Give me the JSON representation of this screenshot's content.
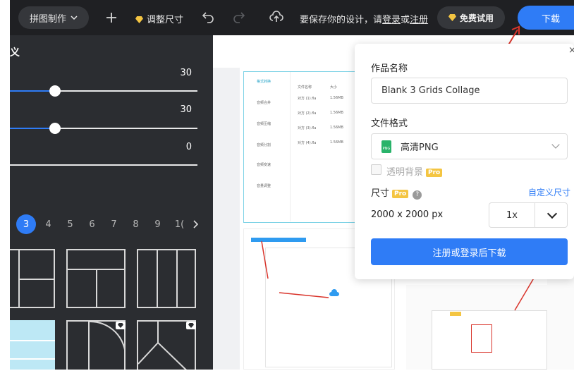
{
  "topbar": {
    "menu_label": "拼图制作",
    "add_icon": "plus-icon",
    "resize_label": "调整尺寸",
    "undo_icon": "undo-icon",
    "redo_icon": "redo-icon",
    "cloud_icon": "cloud-upload-icon",
    "save_prompt_prefix": "要保存你的设计，请",
    "login_link": "登录",
    "or_text": "或",
    "register_link": "注册",
    "trial_label": "免费试用",
    "download_label": "下载"
  },
  "left_panel": {
    "title_fragment": "义",
    "sliders": [
      {
        "value_text": "30",
        "level": 0.24
      },
      {
        "value_text": "30",
        "level": 0.24
      },
      {
        "value_text": "0",
        "level": 0
      }
    ],
    "pages": [
      "3",
      "4",
      "5",
      "6",
      "7",
      "8",
      "9",
      "1("
    ],
    "active_page": "3",
    "next_icon": "chevron-right-icon"
  },
  "canvas": {
    "mini_texts": [
      "格式转换",
      "文件名称",
      "大小",
      "音频合并",
      "音频压缩",
      "音频分割",
      "音频变速",
      "音量调整",
      "对方 (1).fla",
      "对方 (2).fla",
      "对方 (3).fla",
      "对方 (4).fla",
      "1.56MB"
    ]
  },
  "download_popup": {
    "name_label": "作品名称",
    "name_value": "Blank 3 Grids Collage",
    "format_label": "文件格式",
    "format_badge": "PNG",
    "format_value": "高清PNG",
    "transparent_label": "透明背景",
    "pro_badge": "Pro",
    "size_label": "尺寸",
    "help_symbol": "?",
    "custom_size_link": "自定义尺寸",
    "size_value": "2000 x 2000 px",
    "scale_value": "1x",
    "submit_label": "注册或登录后下载",
    "close_symbol": "×"
  },
  "colors": {
    "topbar_bg": "#1f2023",
    "panel_bg": "#2b2d31",
    "accent": "#2f7cf6",
    "pro_gold": "#f4c542"
  }
}
